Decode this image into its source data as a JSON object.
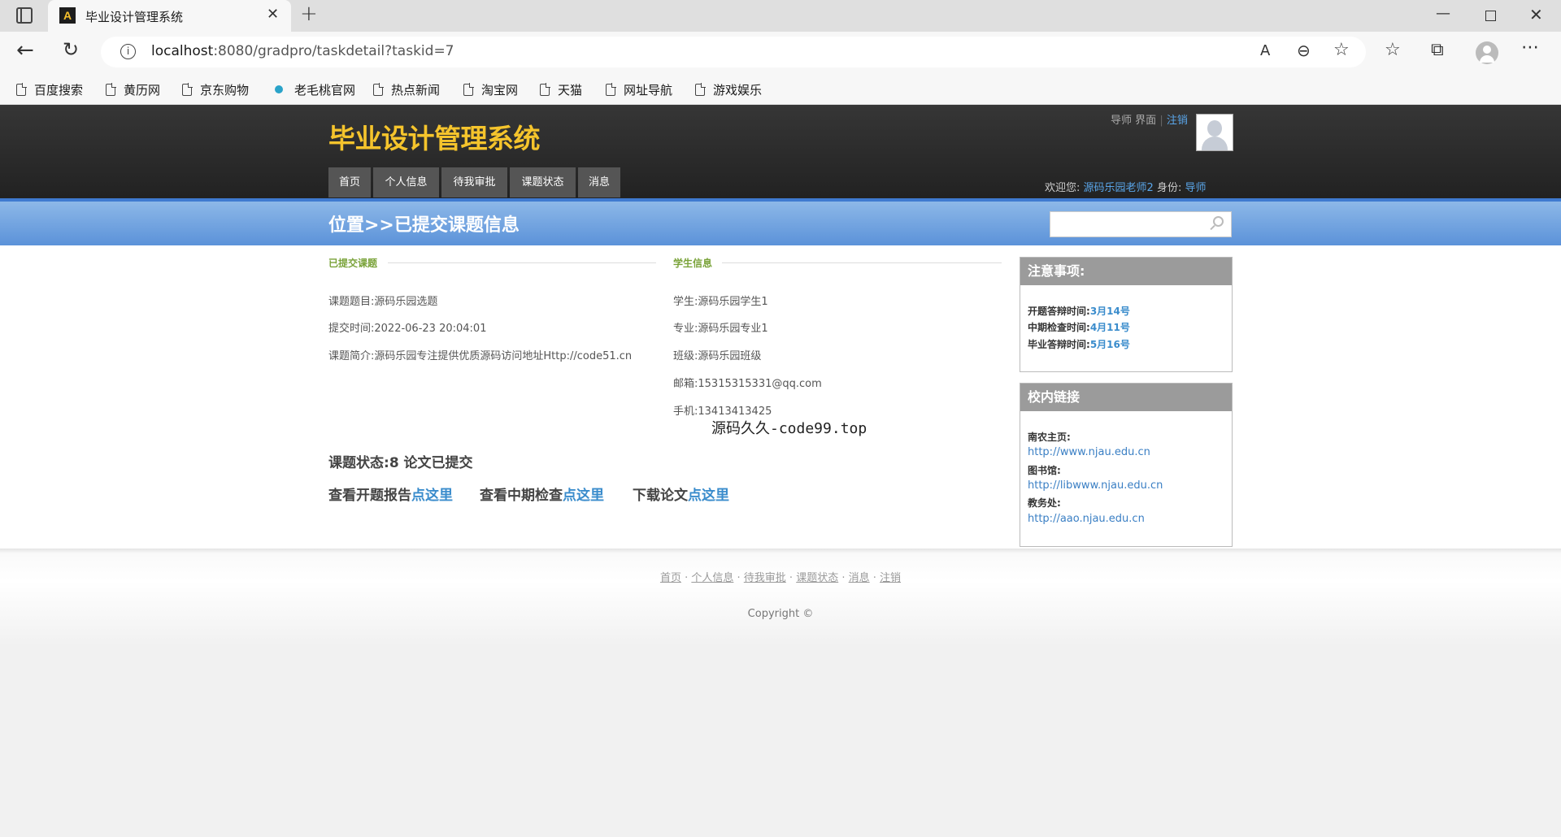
{
  "browser": {
    "tab_title": "毕业设计管理系统",
    "favicon_letter": "A",
    "url_host": "localhost",
    "url_rest": ":8080/gradpro/taskdetail?taskid=7",
    "bookmarks": [
      "百度搜索",
      "黄历网",
      "京东购物",
      "老毛桃官网",
      "热点新闻",
      "淘宝网",
      "天猫",
      "网址导航",
      "游戏娱乐"
    ]
  },
  "header": {
    "site_title": "毕业设计管理系统",
    "nav": [
      "首页",
      "个人信息",
      "待我审批",
      "课题状态",
      "消息"
    ],
    "top_role": "导师",
    "top_page": "界面",
    "logout": "注销",
    "welcome_label": "欢迎您:",
    "user_name": "源码乐园老师2",
    "identity_label": "身份:",
    "identity": "导师"
  },
  "location": {
    "title": "位置>>已提交课题信息"
  },
  "topic": {
    "heading": "已提交课题",
    "title_label": "课题题目:",
    "title": "源码乐园选题",
    "time_label": "提交时间:",
    "time": "2022-06-23 20:04:01",
    "intro_label": "课题简介:",
    "intro": "源码乐园专注提供优质源码访问地址Http://code51.cn"
  },
  "student": {
    "heading": "学生信息",
    "name_label": "学生:",
    "name": "源码乐园学生1",
    "major_label": "专业:",
    "major": "源码乐园专业1",
    "class_label": "班级:",
    "class": "源码乐园班级",
    "email_label": "邮箱:",
    "email": "15315315331@qq.com",
    "phone_label": "手机:",
    "phone": "13413413425"
  },
  "watermark": "源码久久-code99.top",
  "status": {
    "label": "课题状态:",
    "value": "8 论文已提交",
    "report_label": "查看开题报告",
    "midterm_label": "查看中期检查",
    "download_label": "下载论文",
    "click_here": "点这里"
  },
  "notice": {
    "title": "注意事项:",
    "rows": [
      {
        "label": "开题答辩时间:",
        "value": "3月14号"
      },
      {
        "label": "中期检查时间:",
        "value": "4月11号"
      },
      {
        "label": "毕业答辩时间:",
        "value": "5月16号"
      }
    ]
  },
  "links": {
    "title": "校内链接",
    "items": [
      {
        "label": "南农主页:",
        "url": "http://www.njau.edu.cn"
      },
      {
        "label": "图书馆:",
        "url": "http://libwww.njau.edu.cn"
      },
      {
        "label": "教务处:",
        "url": "http://aao.njau.edu.cn"
      }
    ]
  },
  "footer": {
    "links": [
      "首页",
      "个人信息",
      "待我审批",
      "课题状态",
      "消息",
      "注销"
    ],
    "copyright": "Copyright ©"
  }
}
